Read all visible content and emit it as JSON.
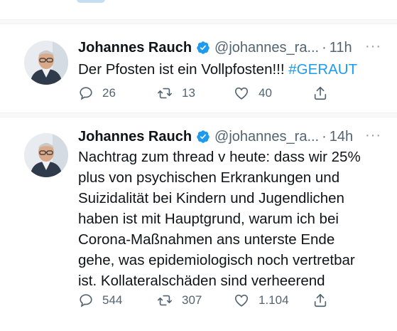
{
  "tweets": [
    {
      "name": "Johannes Rauch",
      "handle": "@johannes_ra...",
      "separator": "·",
      "time": "11h",
      "more": "···",
      "text": "Der Pfosten ist ein Vollpfosten!!! ",
      "hashtag": "#GERAUT",
      "replies": "26",
      "retweets": "13",
      "likes": "40"
    },
    {
      "name": "Johannes Rauch",
      "handle": "@johannes_ra...",
      "separator": "·",
      "time": "14h",
      "more": "···",
      "text": "Nachtrag zum thread v heute: dass wir 25%\nplus von psychischen Erkrankungen und\nSuizidalität bei Kindern und Jugendlichen\nhaben ist mit  Hauptgrund, warum ich bei\nCorona-Maßnahmen ans unterste Ende\ngehe, was epidemiologisch noch vertretbar\nist.  Kollateralschäden sind verheerend",
      "replies": "544",
      "retweets": "307",
      "likes": "1.104"
    }
  ],
  "colors": {
    "accent": "#1d9bf0",
    "text": "#0f1419",
    "secondary": "#536471",
    "divider": "#f7f9f9"
  },
  "icons": [
    "verified-badge-icon",
    "reply-icon",
    "retweet-icon",
    "like-icon",
    "share-icon",
    "more-icon"
  ]
}
